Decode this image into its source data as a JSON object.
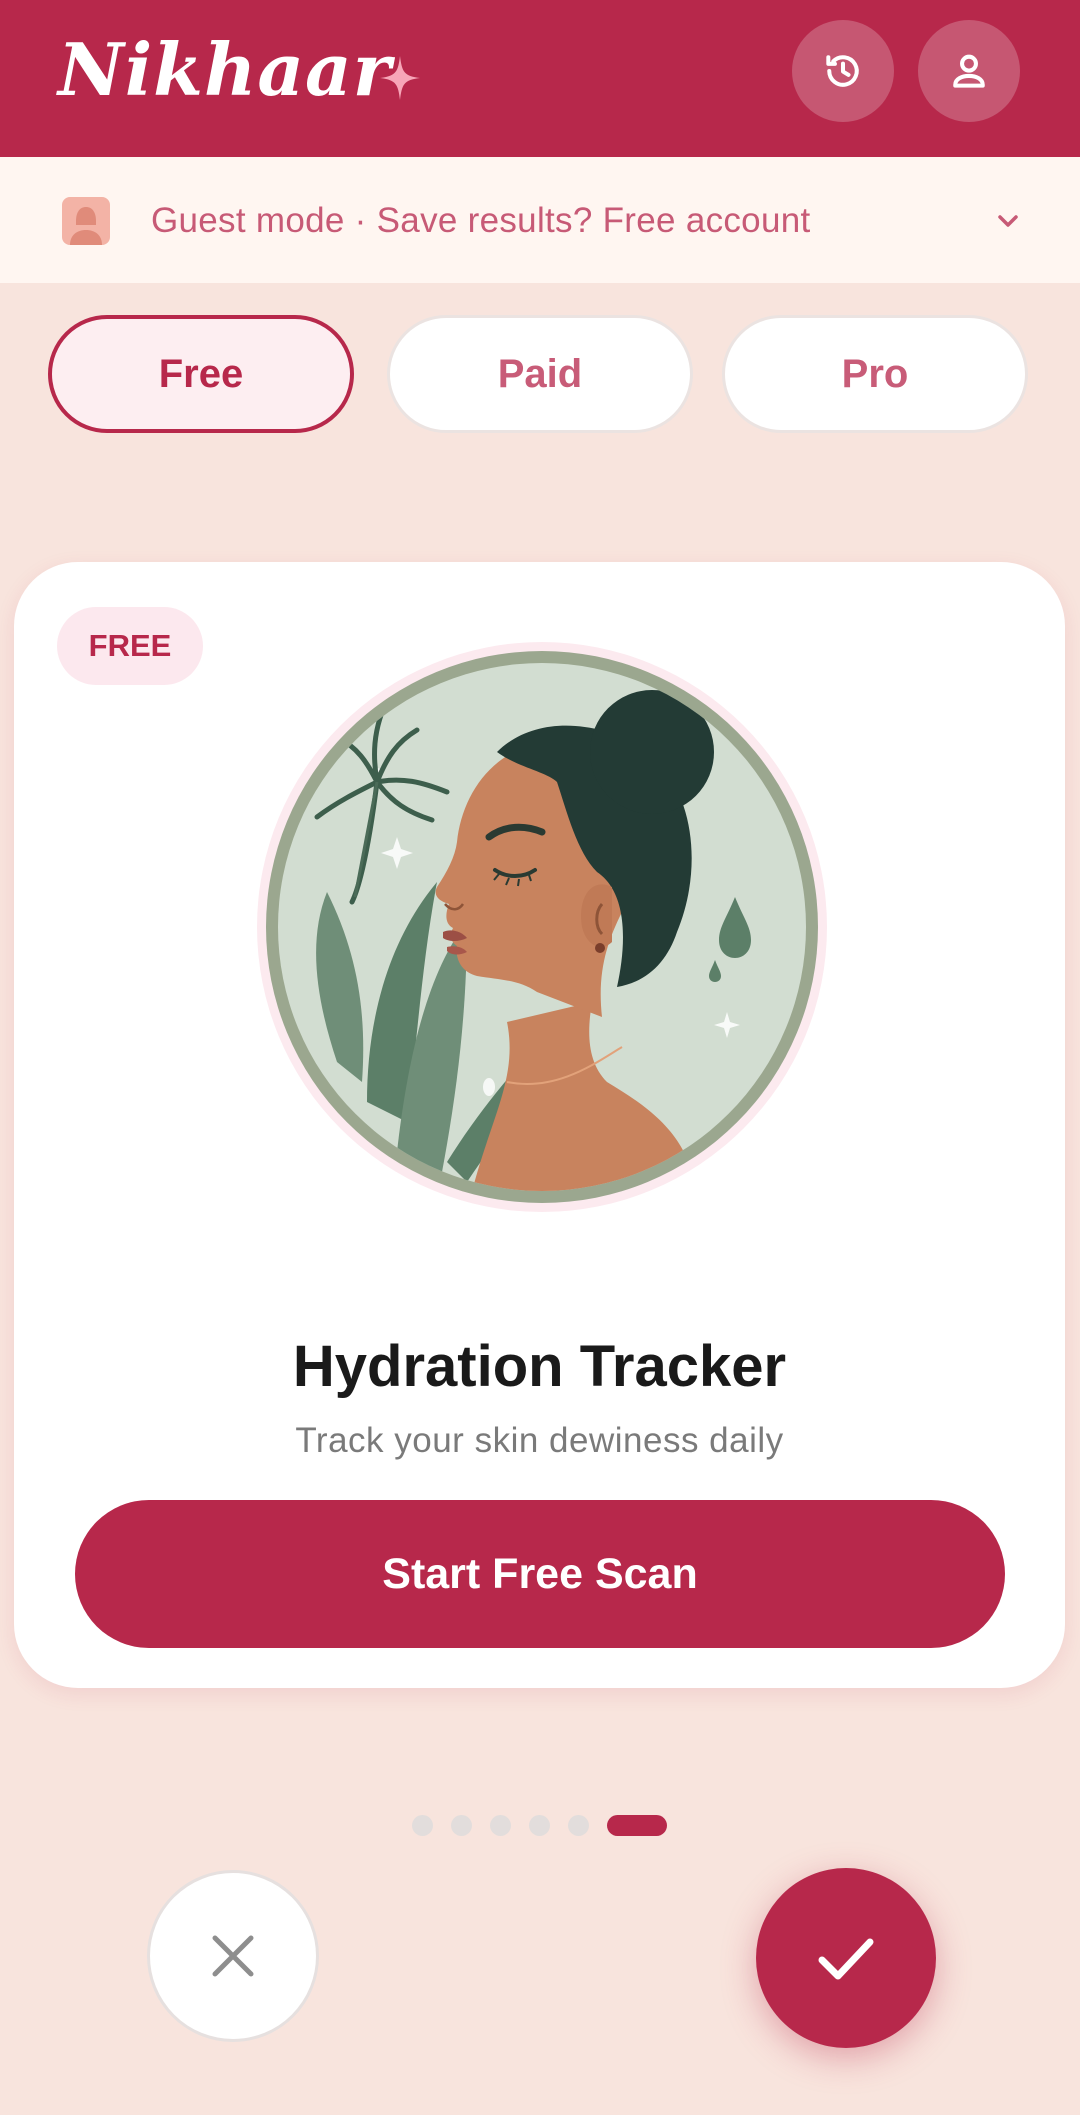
{
  "app": {
    "name": "Nikhaar",
    "colors": {
      "primary": "#B7284B",
      "background": "#F8E4DD",
      "banner": "#FFF6F1",
      "accent_sparkle": "#F7A6B8"
    }
  },
  "header": {
    "history_icon": "history-icon",
    "profile_icon": "person-icon"
  },
  "banner": {
    "text": "Guest mode · Save results? Free account",
    "icon": "user-avatar-icon",
    "expand_icon": "chevron-down-icon"
  },
  "tiers": [
    {
      "label": "Free",
      "selected": true
    },
    {
      "label": "Paid",
      "selected": false
    },
    {
      "label": "Pro",
      "selected": false
    }
  ],
  "card": {
    "badge": "FREE",
    "illustration": "woman-profile-skincare-illustration",
    "title": "Hydration Tracker",
    "subtitle": "Track your skin dewiness daily",
    "cta": "Start Free Scan"
  },
  "pager": {
    "count": 6,
    "active_index": 5
  },
  "actions": {
    "reject_icon": "close-icon",
    "accept_icon": "check-icon"
  }
}
